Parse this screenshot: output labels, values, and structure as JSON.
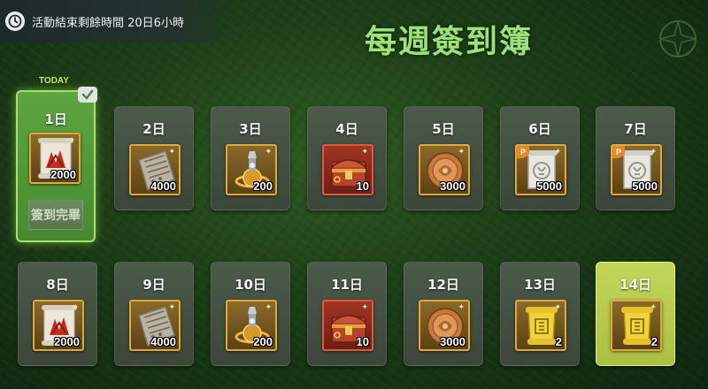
{
  "header": {
    "timer_label": "活動結束剩餘時間 20日6小時",
    "title": "每週簽到簿",
    "today_tag": "TODAY"
  },
  "days": [
    {
      "label": "1日",
      "qty": "2000",
      "item": "red-scroll-icon",
      "frame": "gold",
      "premium": false,
      "claimed": true,
      "claim_label": "簽到完畢"
    },
    {
      "label": "2日",
      "qty": "4000",
      "item": "stone-tablet-icon",
      "frame": "gold",
      "premium": false
    },
    {
      "label": "3日",
      "qty": "200",
      "item": "potion-orb-icon",
      "frame": "gold",
      "premium": false
    },
    {
      "label": "4日",
      "qty": "10",
      "item": "treasure-chest-icon",
      "frame": "red",
      "premium": false
    },
    {
      "label": "5日",
      "qty": "3000",
      "item": "copper-coin-icon",
      "frame": "gold",
      "premium": false
    },
    {
      "label": "6日",
      "qty": "5000",
      "item": "silver-scroll-icon",
      "frame": "gold",
      "premium": true,
      "badge": "P"
    },
    {
      "label": "7日",
      "qty": "5000",
      "item": "silver-scroll-icon",
      "frame": "gold",
      "premium": true,
      "badge": "P"
    },
    {
      "label": "8日",
      "qty": "2000",
      "item": "red-scroll-icon",
      "frame": "gold",
      "premium": false
    },
    {
      "label": "9日",
      "qty": "4000",
      "item": "stone-tablet-icon",
      "frame": "gold",
      "premium": false
    },
    {
      "label": "10日",
      "qty": "200",
      "item": "potion-orb-icon",
      "frame": "gold",
      "premium": false
    },
    {
      "label": "11日",
      "qty": "10",
      "item": "treasure-chest-icon",
      "frame": "red",
      "premium": false
    },
    {
      "label": "12日",
      "qty": "3000",
      "item": "copper-coin-icon",
      "frame": "gold",
      "premium": false
    },
    {
      "label": "13日",
      "qty": "2",
      "item": "gold-scroll-icon",
      "frame": "gold",
      "premium": false
    },
    {
      "label": "14日",
      "qty": "2",
      "item": "gold-scroll-icon",
      "frame": "gold",
      "premium": false,
      "highlight": true
    }
  ],
  "colors": {
    "today_border": "#a8e070",
    "highlight_bg": "#c2d65a",
    "title_green": "#9fe07a",
    "today_tag": "#c8e64a"
  }
}
